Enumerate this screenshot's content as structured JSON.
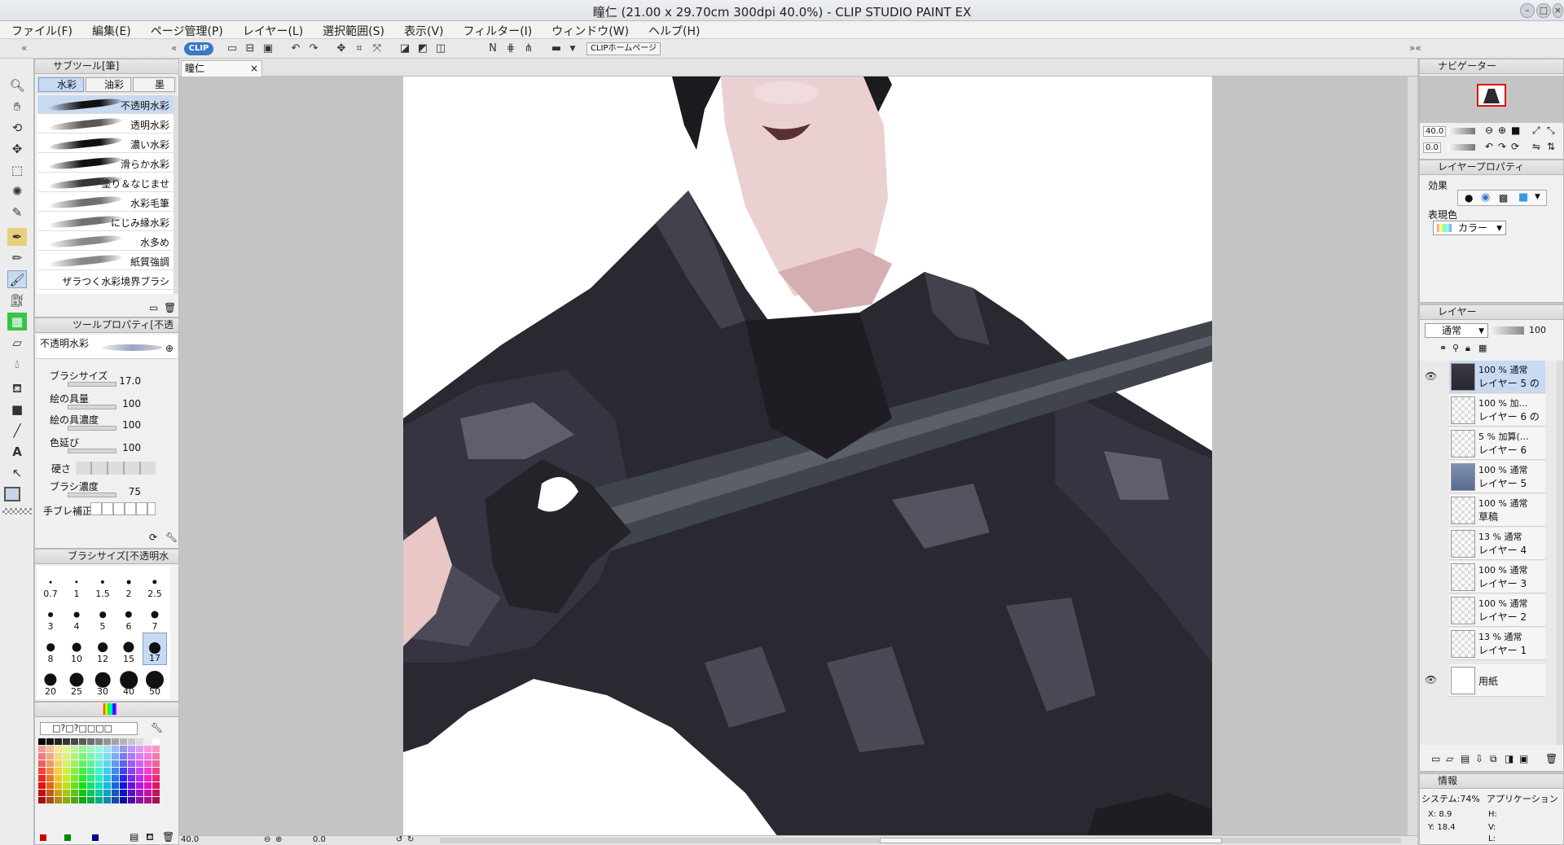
{
  "window": {
    "title": "瞳仁 (21.00 x 29.70cm 300dpi 40.0%)  - CLIP STUDIO PAINT EX"
  },
  "menu": [
    "ファイル(F)",
    "編集(E)",
    "ページ管理(P)",
    "レイヤー(L)",
    "選択範囲(S)",
    "表示(V)",
    "フィルター(I)",
    "ウィンドウ(W)",
    "ヘルプ(H)"
  ],
  "cmdbar": {
    "clip_logo": "CLIP",
    "home_button": "CLIPホームページ"
  },
  "document_tab": "瞳仁",
  "subtool": {
    "title": "サブツール[筆]",
    "groups": [
      "水彩",
      "油彩",
      "墨"
    ],
    "brushes": [
      "不透明水彩",
      "透明水彩",
      "濃い水彩",
      "滑らか水彩",
      "塗り＆なじませ",
      "水彩毛筆",
      "にじみ縁水彩",
      "水多め",
      "紙質強調",
      "ザラつく水彩境界ブラシ"
    ]
  },
  "toolprop": {
    "title": "ツールプロパティ[不透",
    "current": "不透明水彩",
    "props": [
      {
        "label": "ブラシサイズ",
        "value": "17.0"
      },
      {
        "label": "絵の具量",
        "value": "100"
      },
      {
        "label": "絵の具濃度",
        "value": "100"
      },
      {
        "label": "色延び",
        "value": "100"
      },
      {
        "label": "硬さ",
        "value": ""
      },
      {
        "label": "ブラシ濃度",
        "value": "75"
      },
      {
        "label": "手ブレ補正",
        "value": ""
      }
    ]
  },
  "brushsize": {
    "title": "ブラシサイズ[不透明水",
    "sizes": [
      "0.7",
      "1",
      "1.5",
      "2",
      "2.5",
      "3",
      "4",
      "5",
      "6",
      "7",
      "8",
      "10",
      "12",
      "15",
      "17",
      "20",
      "25",
      "30",
      "40",
      "50"
    ],
    "selected": "17"
  },
  "color_palette": {
    "preset_label": "□?□?□□□□"
  },
  "status": {
    "zoom": "40.0",
    "angle": "0.0"
  },
  "navigator": {
    "title": "ナビゲーター",
    "zoom": "40.0",
    "rotate": "0.0"
  },
  "layer_property": {
    "title": "レイヤープロパティ",
    "effect_label": "効果",
    "color_label": "表現色",
    "color_value": "カラー"
  },
  "layers": {
    "title": "レイヤー",
    "blend_mode": "通常",
    "opacity": "100",
    "items": [
      {
        "mode": "100 % 通常",
        "name": "レイヤー 5 の"
      },
      {
        "mode": "100 % 加…",
        "name": "レイヤー 6 の"
      },
      {
        "mode": "5 % 加算(…",
        "name": "レイヤー 6"
      },
      {
        "mode": "100 % 通常",
        "name": "レイヤー 5"
      },
      {
        "mode": "100 % 通常",
        "name": "草稿"
      },
      {
        "mode": "13 % 通常",
        "name": "レイヤー 4"
      },
      {
        "mode": "100 % 通常",
        "name": "レイヤー 3"
      },
      {
        "mode": "100 % 通常",
        "name": "レイヤー 2"
      },
      {
        "mode": "13 % 通常",
        "name": "レイヤー 1"
      },
      {
        "mode": "",
        "name": "用紙"
      }
    ]
  },
  "info": {
    "title": "情報",
    "system": "システム:74%",
    "app": "アプリケーション",
    "x": "X: 8.9",
    "y": "Y: 18.4",
    "h": "H:",
    "v": "V:",
    "l": "L:"
  },
  "colors": {
    "accent": "#3a78c8",
    "panel": "#f0f0f0",
    "canvas_bg": "#c4c4c4"
  }
}
